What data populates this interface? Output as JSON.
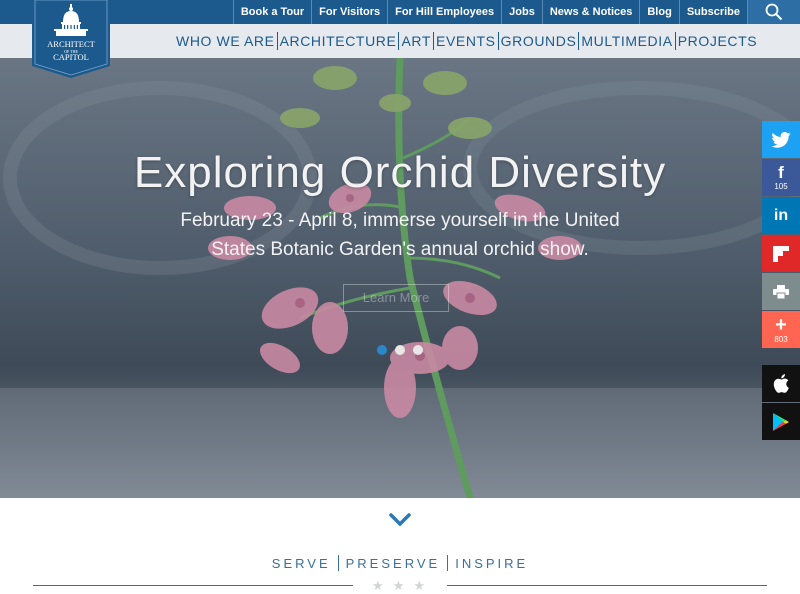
{
  "topbar": {
    "links": [
      "Book a Tour",
      "For Visitors",
      "For Hill Employees",
      "Jobs",
      "News & Notices",
      "Blog",
      "Subscribe"
    ],
    "search_icon": "search-icon"
  },
  "logo": {
    "line1": "ARCHITECT",
    "line2": "OF THE",
    "line3": "CAPITOL"
  },
  "nav": {
    "items": [
      "WHO WE ARE",
      "ARCHITECTURE",
      "ART",
      "EVENTS",
      "GROUNDS",
      "MULTIMEDIA",
      "PROJECTS"
    ]
  },
  "hero": {
    "title": "Exploring Orchid Diversity",
    "subtitle": "February 23 - April 8, immerse yourself in the United States Botanic Garden's annual orchid show.",
    "button": "Learn More",
    "slides_total": 3,
    "active_slide": 1
  },
  "social": {
    "twitter_icon": "twitter-icon",
    "facebook_count": "105",
    "linkedin_icon": "linkedin-icon",
    "flipboard_icon": "flipboard-icon",
    "print_icon": "print-icon",
    "share_count": "803",
    "apple_icon": "apple-icon",
    "play_icon": "google-play-icon"
  },
  "tagline": {
    "words": [
      "SERVE",
      "PRESERVE",
      "INSPIRE"
    ]
  },
  "colors": {
    "brand_blue": "#1c5a8e",
    "twitter": "#1da1f2",
    "facebook": "#3b5998",
    "linkedin": "#0077b5",
    "flipboard": "#e12828",
    "print": "#7f8c8d",
    "share": "#ff6550",
    "active_dot": "#2a88c8"
  }
}
